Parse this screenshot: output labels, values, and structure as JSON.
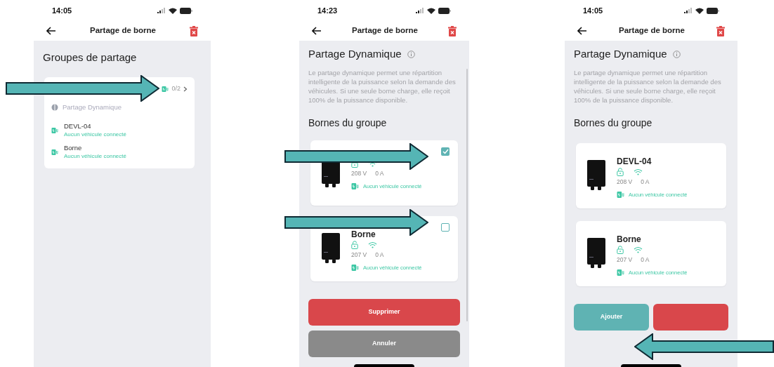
{
  "screen_1": {
    "status_time": "14:05",
    "title": "Partage de borne",
    "heading": "Groupes de partage",
    "group": {
      "count": "0/2",
      "mode": "Partage Dynamique",
      "stations": [
        {
          "name": "DEVL-04",
          "status": "Aucun véhicule connecté"
        },
        {
          "name": "Borne",
          "status": "Aucun véhicule connecté"
        }
      ]
    }
  },
  "screen_2": {
    "status_time": "14:23",
    "title": "Partage de borne",
    "heading": "Partage Dynamique",
    "description": "Le partage dynamique permet une répartition intelligente de la puissance selon la demande des véhicules. Si une seule borne charge, elle reçoit 100% de la puissance disponible.",
    "section": "Bornes du groupe",
    "stations": [
      {
        "voltage": "208 V",
        "current": "0 A",
        "status": "Aucun véhicule connecté",
        "checked": true
      },
      {
        "name": "Borne",
        "voltage": "207 V",
        "current": "0 A",
        "status": "Aucun véhicule connecté",
        "checked": false
      }
    ],
    "buttons": [
      {
        "label": "Supprimer",
        "kind": "danger"
      },
      {
        "label": "Annuler",
        "kind": "neutral"
      }
    ]
  },
  "screen_3": {
    "status_time": "14:05",
    "title": "Partage de borne",
    "heading": "Partage Dynamique",
    "description": "Le partage dynamique permet une répartition intelligente de la puissance selon la demande des véhicules. Si une seule borne charge, elle reçoit 100% de la puissance disponible.",
    "section": "Bornes du groupe",
    "stations": [
      {
        "name": "DEVL-04",
        "voltage": "208 V",
        "current": "0 A",
        "status": "Aucun véhicule connecté"
      },
      {
        "name": "Borne",
        "voltage": "207 V",
        "current": "0 A",
        "status": "Aucun véhicule connecté"
      }
    ],
    "buttons": [
      {
        "label": "Ajouter",
        "kind": "primary"
      },
      {
        "kind": "danger"
      }
    ]
  }
}
